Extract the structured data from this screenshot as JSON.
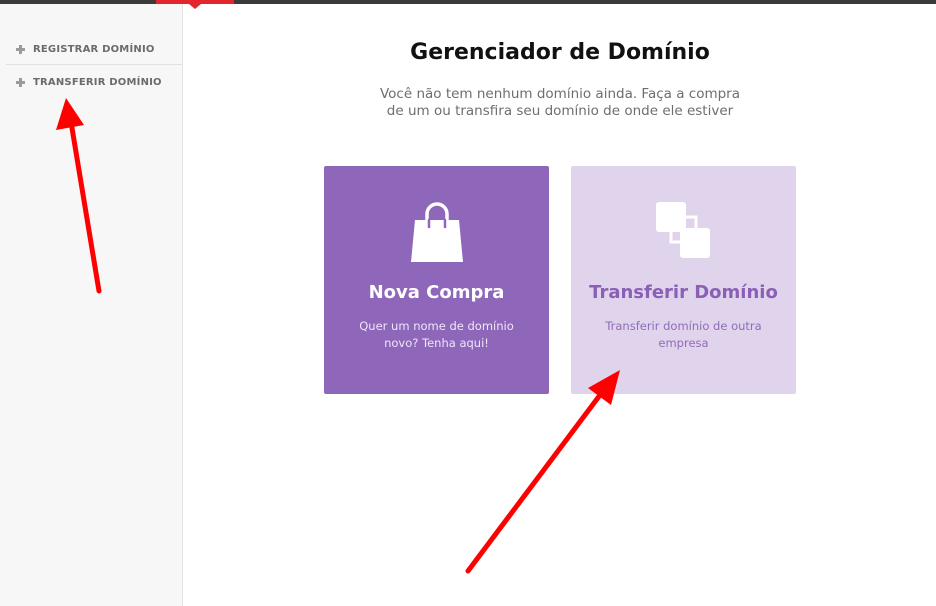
{
  "sidebar": {
    "items": [
      {
        "label": "REGISTRAR DOMÍNIO",
        "icon": "plus-icon"
      },
      {
        "label": "TRANSFERIR DOMÍNIO",
        "icon": "plus-icon"
      }
    ]
  },
  "main": {
    "title": "Gerenciador de Domínio",
    "subtitle_line1": "Você não tem nenhum domínio ainda. Faça a compra",
    "subtitle_line2": "de um ou transfira seu domínio de onde ele estiver",
    "cards": [
      {
        "title": "Nova Compra",
        "desc": "Quer um nome de domínio novo? Tenha aqui!",
        "icon": "shopping-bag-icon",
        "color": "#8f67ba"
      },
      {
        "title": "Transferir Domínio",
        "desc": "Transferir domínio de outra empresa",
        "icon": "transfer-squares-icon",
        "color": "#e0d4ec"
      }
    ]
  },
  "colors": {
    "topbar": "#3a3a3a",
    "topbar_accent": "#e3262d",
    "annotation_arrow": "#ff0000"
  }
}
